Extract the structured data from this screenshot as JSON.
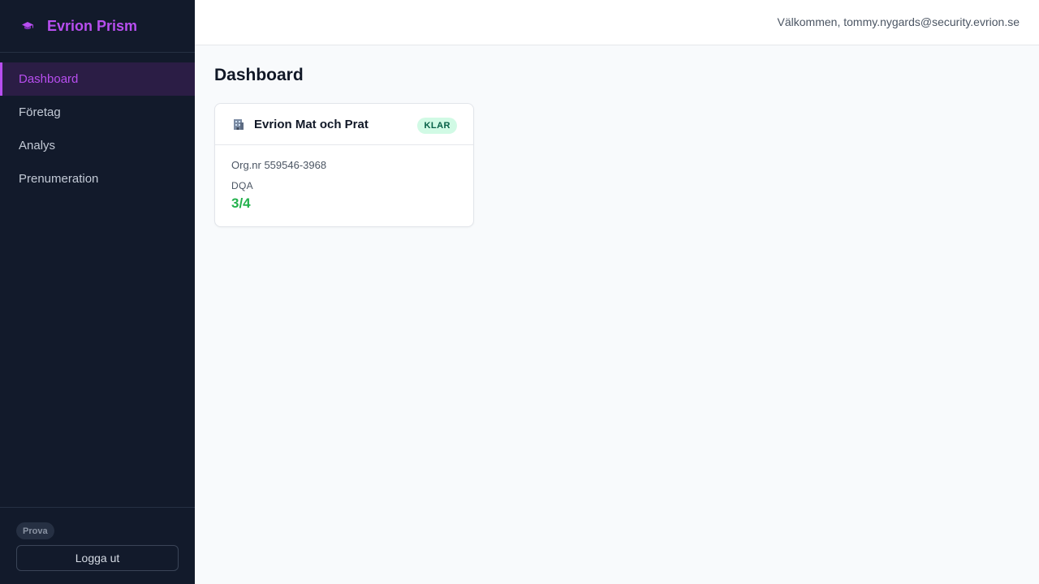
{
  "brand": {
    "name": "Evrion Prism",
    "icon": "graduation-cap-icon",
    "accent": "#b84ef0"
  },
  "sidebar": {
    "items": [
      {
        "label": "Dashboard",
        "active": true
      },
      {
        "label": "Företag",
        "active": false
      },
      {
        "label": "Analys",
        "active": false
      },
      {
        "label": "Prenumeration",
        "active": false
      }
    ],
    "plan_badge": "Prova",
    "logout_label": "Logga ut"
  },
  "header": {
    "welcome": "Välkommen, tommy.nygards@security.evrion.se"
  },
  "main": {
    "title": "Dashboard",
    "cards": [
      {
        "icon": "office-building-icon",
        "name": "Evrion Mat och Prat",
        "status": "KLAR",
        "status_color": "#d1fae5",
        "org": "Org.nr 559546-3968",
        "dqa_label": "DQA",
        "dqa_value": "3/4",
        "dqa_color": "#22b14c"
      }
    ]
  }
}
